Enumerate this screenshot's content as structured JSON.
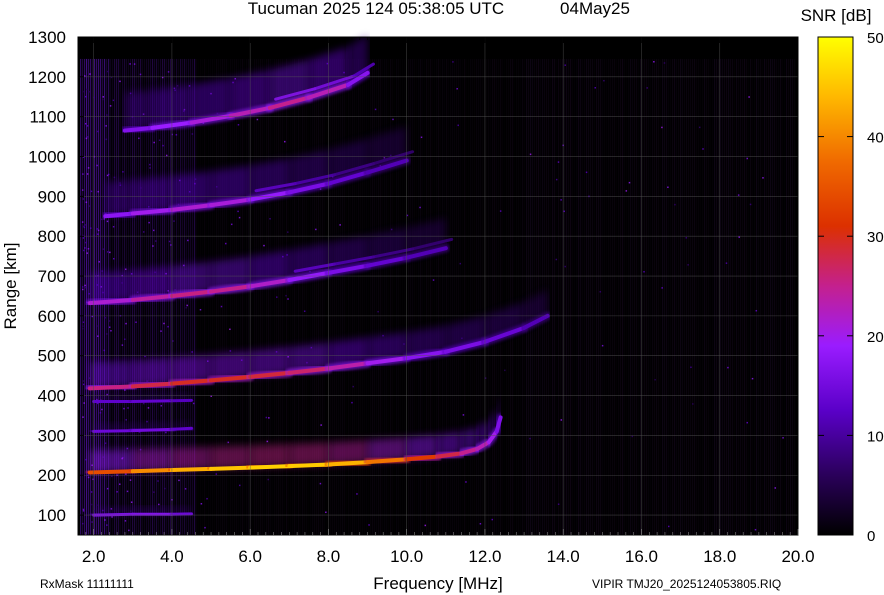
{
  "chart_data": {
    "type": "heatmap",
    "title": "Tucuman 2025 124 05:38:05 UTC",
    "date": "04May25",
    "xlabel": "Frequency [MHz]",
    "ylabel": "Range [km]",
    "xlim": [
      1.6,
      20.0
    ],
    "ylim": [
      50,
      1300
    ],
    "xticks": [
      "2.0",
      "4.0",
      "6.0",
      "8.0",
      "10.0",
      "12.0",
      "14.0",
      "16.0",
      "18.0",
      "20.0"
    ],
    "xtick_values": [
      2,
      4,
      6,
      8,
      10,
      12,
      14,
      16,
      18,
      20
    ],
    "yticks": [
      "100",
      "200",
      "300",
      "400",
      "500",
      "600",
      "700",
      "800",
      "900",
      "1000",
      "1100",
      "1200",
      "1300"
    ],
    "ytick_values": [
      100,
      200,
      300,
      400,
      500,
      600,
      700,
      800,
      900,
      1000,
      1100,
      1200,
      1300
    ],
    "colorbar": {
      "label": "SNR [dB]",
      "range": [
        0,
        50
      ],
      "ticks": [
        "0",
        "10",
        "20",
        "30",
        "40",
        "50"
      ],
      "tick_values": [
        0,
        10,
        20,
        30,
        40,
        50
      ]
    },
    "traces": [
      {
        "hop": 1,
        "points": [
          [
            1.9,
            207
          ],
          [
            3.0,
            210
          ],
          [
            4.0,
            213
          ],
          [
            5.0,
            216
          ],
          [
            6.0,
            219
          ],
          [
            7.0,
            223
          ],
          [
            8.0,
            227
          ],
          [
            9.0,
            233
          ],
          [
            10.0,
            240
          ],
          [
            10.8,
            247
          ],
          [
            11.4,
            255
          ],
          [
            11.8,
            266
          ],
          [
            12.1,
            283
          ],
          [
            12.3,
            310
          ],
          [
            12.4,
            345
          ]
        ],
        "snr": [
          30,
          38,
          42,
          44,
          46,
          46,
          45,
          42,
          34,
          30,
          26,
          24,
          22,
          18,
          14
        ]
      },
      {
        "hop": 2,
        "points": [
          [
            1.9,
            418
          ],
          [
            3.0,
            423
          ],
          [
            4.0,
            430
          ],
          [
            5.0,
            438
          ],
          [
            6.0,
            447
          ],
          [
            7.0,
            457
          ],
          [
            8.0,
            468
          ],
          [
            9.0,
            481
          ],
          [
            10.0,
            494
          ],
          [
            11.0,
            510
          ],
          [
            12.0,
            535
          ],
          [
            13.0,
            570
          ],
          [
            13.6,
            600
          ]
        ],
        "snr": [
          24,
          27,
          29,
          30,
          29,
          28,
          25,
          22,
          18,
          16,
          15,
          12,
          10
        ]
      },
      {
        "hop": 3,
        "points": [
          [
            1.9,
            632
          ],
          [
            3.0,
            640
          ],
          [
            4.0,
            650
          ],
          [
            5.0,
            661
          ],
          [
            6.0,
            674
          ],
          [
            7.0,
            690
          ],
          [
            8.0,
            708
          ],
          [
            9.0,
            726
          ],
          [
            10.0,
            746
          ],
          [
            11.0,
            770
          ]
        ],
        "snr": [
          20,
          23,
          25,
          26,
          24,
          20,
          17,
          14,
          12,
          10
        ]
      },
      {
        "hop": 4,
        "points": [
          [
            2.3,
            850
          ],
          [
            3.0,
            857
          ],
          [
            4.0,
            866
          ],
          [
            5.0,
            878
          ],
          [
            6.0,
            892
          ],
          [
            7.0,
            910
          ],
          [
            8.0,
            932
          ],
          [
            9.0,
            960
          ],
          [
            10.0,
            990
          ]
        ],
        "snr": [
          16,
          19,
          21,
          22,
          20,
          17,
          14,
          12,
          10
        ]
      },
      {
        "hop": 5,
        "points": [
          [
            2.8,
            1065
          ],
          [
            3.5,
            1072
          ],
          [
            4.5,
            1085
          ],
          [
            5.5,
            1102
          ],
          [
            6.5,
            1122
          ],
          [
            7.5,
            1148
          ],
          [
            8.5,
            1180
          ],
          [
            9.0,
            1210
          ]
        ],
        "snr": [
          15,
          18,
          20,
          22,
          24,
          26,
          20,
          14
        ]
      },
      {
        "hop": 0,
        "points": [
          [
            2.0,
            100
          ],
          [
            3.0,
            102
          ],
          [
            4.0,
            102
          ],
          [
            4.5,
            103
          ]
        ],
        "snr": [
          15,
          17,
          16,
          12
        ]
      },
      {
        "hop": 0,
        "points": [
          [
            2.0,
            310
          ],
          [
            3.0,
            312
          ],
          [
            4.0,
            315
          ],
          [
            4.5,
            318
          ]
        ],
        "snr": [
          13,
          15,
          14,
          11
        ]
      },
      {
        "hop": 0,
        "points": [
          [
            2.0,
            385
          ],
          [
            3.0,
            385
          ],
          [
            4.0,
            387
          ],
          [
            4.5,
            388
          ]
        ],
        "snr": [
          12,
          13,
          13,
          10
        ]
      }
    ]
  },
  "footer": {
    "rxmask": "RxMask 11111111",
    "file": "VIPIR  TMJ20_2025124053805.RIQ"
  }
}
